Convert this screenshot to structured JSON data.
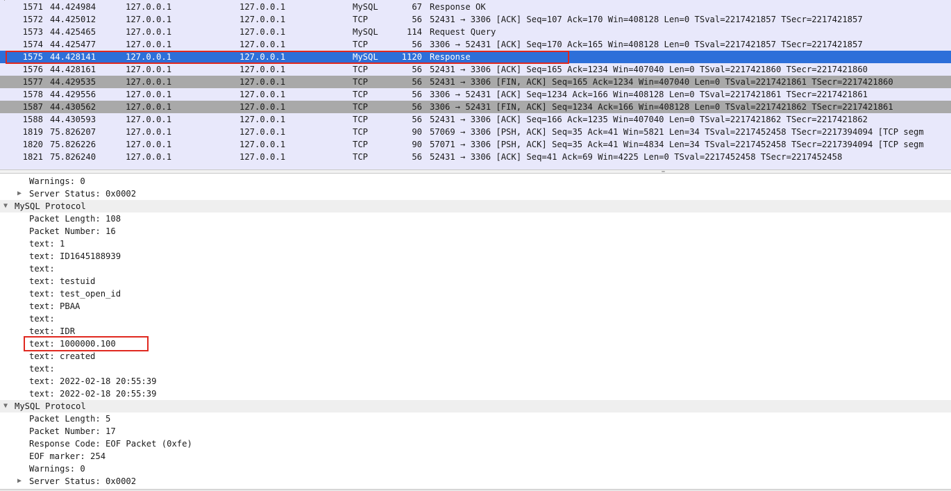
{
  "packets": [
    {
      "no": "1571",
      "time": "44.424984",
      "src": "127.0.0.1",
      "dst": "127.0.0.1",
      "proto": "MySQL",
      "len": "67",
      "info": "Response OK"
    },
    {
      "no": "1572",
      "time": "44.425012",
      "src": "127.0.0.1",
      "dst": "127.0.0.1",
      "proto": "TCP",
      "len": "56",
      "info": "52431 → 3306 [ACK] Seq=107 Ack=170 Win=408128 Len=0 TSval=2217421857 TSecr=2217421857"
    },
    {
      "no": "1573",
      "time": "44.425465",
      "src": "127.0.0.1",
      "dst": "127.0.0.1",
      "proto": "MySQL",
      "len": "114",
      "info": "Request Query"
    },
    {
      "no": "1574",
      "time": "44.425477",
      "src": "127.0.0.1",
      "dst": "127.0.0.1",
      "proto": "TCP",
      "len": "56",
      "info": "3306 → 52431 [ACK] Seq=170 Ack=165 Win=408128 Len=0 TSval=2217421857 TSecr=2217421857"
    },
    {
      "no": "1575",
      "time": "44.428141",
      "src": "127.0.0.1",
      "dst": "127.0.0.1",
      "proto": "MySQL",
      "len": "1120",
      "info": "Response"
    },
    {
      "no": "1576",
      "time": "44.428161",
      "src": "127.0.0.1",
      "dst": "127.0.0.1",
      "proto": "TCP",
      "len": "56",
      "info": "52431 → 3306 [ACK] Seq=165 Ack=1234 Win=407040 Len=0 TSval=2217421860 TSecr=2217421860"
    },
    {
      "no": "1577",
      "time": "44.429535",
      "src": "127.0.0.1",
      "dst": "127.0.0.1",
      "proto": "TCP",
      "len": "56",
      "info": "52431 → 3306 [FIN, ACK] Seq=165 Ack=1234 Win=407040 Len=0 TSval=2217421861 TSecr=2217421860"
    },
    {
      "no": "1578",
      "time": "44.429556",
      "src": "127.0.0.1",
      "dst": "127.0.0.1",
      "proto": "TCP",
      "len": "56",
      "info": "3306 → 52431 [ACK] Seq=1234 Ack=166 Win=408128 Len=0 TSval=2217421861 TSecr=2217421861"
    },
    {
      "no": "1587",
      "time": "44.430562",
      "src": "127.0.0.1",
      "dst": "127.0.0.1",
      "proto": "TCP",
      "len": "56",
      "info": "3306 → 52431 [FIN, ACK] Seq=1234 Ack=166 Win=408128 Len=0 TSval=2217421862 TSecr=2217421861"
    },
    {
      "no": "1588",
      "time": "44.430593",
      "src": "127.0.0.1",
      "dst": "127.0.0.1",
      "proto": "TCP",
      "len": "56",
      "info": "52431 → 3306 [ACK] Seq=166 Ack=1235 Win=407040 Len=0 TSval=2217421862 TSecr=2217421862"
    },
    {
      "no": "1819",
      "time": "75.826207",
      "src": "127.0.0.1",
      "dst": "127.0.0.1",
      "proto": "TCP",
      "len": "90",
      "info": "57069 → 3306 [PSH, ACK] Seq=35 Ack=41 Win=5821 Len=34 TSval=2217452458 TSecr=2217394094 [TCP segm"
    },
    {
      "no": "1820",
      "time": "75.826226",
      "src": "127.0.0.1",
      "dst": "127.0.0.1",
      "proto": "TCP",
      "len": "90",
      "info": "57071 → 3306 [PSH, ACK] Seq=35 Ack=41 Win=4834 Len=34 TSval=2217452458 TSecr=2217394094 [TCP segm"
    },
    {
      "no": "1821",
      "time": "75.826240",
      "src": "127.0.0.1",
      "dst": "127.0.0.1",
      "proto": "TCP",
      "len": "56",
      "info": "52431 → 3306 [ACK] Seq=41 Ack=69 Win=4225 Len=0 TSval=2217452458 TSecr=2217452458"
    }
  ],
  "selected_packet": "1575",
  "gray_packets": [
    "1577",
    "1587"
  ],
  "details": [
    {
      "level": 1,
      "text": "Warnings: 0"
    },
    {
      "level": 1,
      "text": "Server Status: 0x0002",
      "expander": "collapsed"
    },
    {
      "level": 0,
      "text": "MySQL Protocol",
      "expander": "expanded"
    },
    {
      "level": 1,
      "text": "Packet Length: 108"
    },
    {
      "level": 1,
      "text": "Packet Number: 16"
    },
    {
      "level": 1,
      "text": "text: 1"
    },
    {
      "level": 1,
      "text": "text: ID1645188939"
    },
    {
      "level": 1,
      "text": "text:"
    },
    {
      "level": 1,
      "text": "text: testuid"
    },
    {
      "level": 1,
      "text": "text: test_open_id"
    },
    {
      "level": 1,
      "text": "text: PBAA"
    },
    {
      "level": 1,
      "text": "text:"
    },
    {
      "level": 1,
      "text": "text: IDR"
    },
    {
      "level": 1,
      "text": "text: 1000000.100",
      "highlighted": true
    },
    {
      "level": 1,
      "text": "text: created"
    },
    {
      "level": 1,
      "text": "text:"
    },
    {
      "level": 1,
      "text": "text: 2022-02-18 20:55:39"
    },
    {
      "level": 1,
      "text": "text: 2022-02-18 20:55:39"
    },
    {
      "level": 0,
      "text": "MySQL Protocol",
      "expander": "expanded"
    },
    {
      "level": 1,
      "text": "Packet Length: 5"
    },
    {
      "level": 1,
      "text": "Packet Number: 17"
    },
    {
      "level": 1,
      "text": "Response Code: EOF Packet (0xfe)"
    },
    {
      "level": 1,
      "text": "EOF marker: 254"
    },
    {
      "level": 1,
      "text": "Warnings: 0"
    },
    {
      "level": 1,
      "text": "Server Status: 0x0002",
      "expander": "collapsed"
    }
  ],
  "colors": {
    "row_bg": "#e8e8fb",
    "row_gray": "#a9a9a9",
    "selected": "#2d6fd9",
    "annotation": "#e0281f"
  },
  "icons": {
    "expanded": "triangle-down-icon",
    "collapsed": "triangle-right-icon"
  }
}
